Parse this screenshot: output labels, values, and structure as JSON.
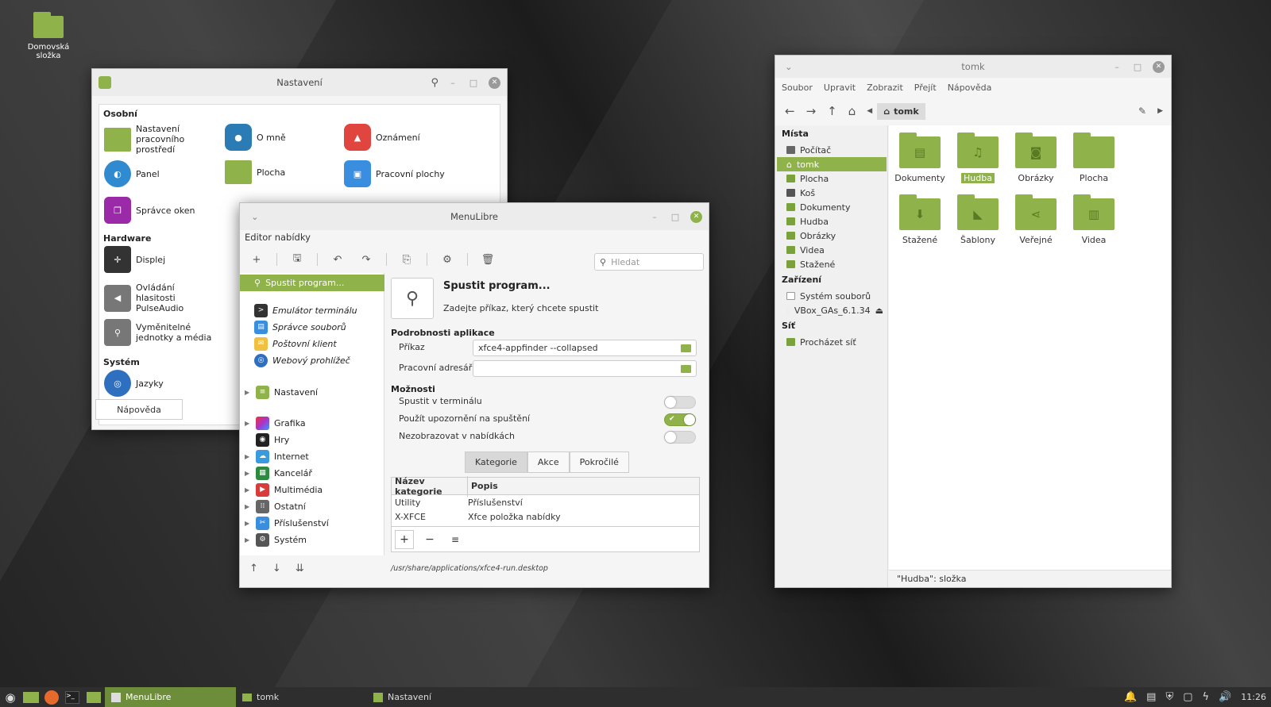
{
  "desktop": {
    "home_label": "Domovská složka"
  },
  "settings": {
    "title": "Nastavení",
    "help": "Nápověda",
    "sections": [
      "Osobní",
      "Hardware",
      "Systém"
    ],
    "items": {
      "desktop_env": "Nastavení pracovního prostředí",
      "about": "O mně",
      "notif": "Oznámení",
      "panel": "Panel",
      "plocha": "Plocha",
      "workspaces": "Pracovní plochy",
      "wm": "Správce oken",
      "display": "Displej",
      "audio": "Ovládání hlasitosti PulseAudio",
      "removable": "Vyměnitelné jednotky a média",
      "lang": "Jazyky"
    }
  },
  "menulibre": {
    "title": "MenuLibre",
    "subtitle": "Editor nabídky",
    "search_placeholder": "Hledat",
    "tree": {
      "selected": "Spustit program...",
      "children": [
        "Emulátor terminálu",
        "Správce souborů",
        "Poštovní klient",
        "Webový prohlížeč"
      ],
      "categories": [
        "Nastavení",
        "Grafika",
        "Hry",
        "Internet",
        "Kancelář",
        "Multimédia",
        "Ostatní",
        "Příslušenství",
        "Systém"
      ]
    },
    "app": {
      "name": "Spustit program...",
      "comment": "Zadejte příkaz, který chcete spustit"
    },
    "details_heading": "Podrobnosti aplikace",
    "command_label": "Příkaz",
    "command_value": "xfce4-appfinder --collapsed",
    "workdir_label": "Pracovní adresář",
    "workdir_value": "",
    "options_heading": "Možnosti",
    "options": [
      {
        "label": "Spustit v terminálu",
        "on": false
      },
      {
        "label": "Použít upozornění na spuštění",
        "on": true
      },
      {
        "label": "Nezobrazovat v nabídkách",
        "on": false
      }
    ],
    "tabs": [
      "Kategorie",
      "Akce",
      "Pokročilé"
    ],
    "table_headers": [
      "Název kategorie",
      "Popis"
    ],
    "table_rows": [
      [
        "Utility",
        "Příslušenství"
      ],
      [
        "X-XFCE",
        "Xfce položka nabídky"
      ]
    ],
    "path": "/usr/share/applications/xfce4-run.desktop"
  },
  "nemo": {
    "title": "tomk",
    "menu": [
      "Soubor",
      "Upravit",
      "Zobrazit",
      "Přejít",
      "Nápověda"
    ],
    "path_label": "tomk",
    "sidebar": {
      "places_heading": "Místa",
      "places": [
        "Počítač",
        "tomk",
        "Plocha",
        "Koš",
        "Dokumenty",
        "Hudba",
        "Obrázky",
        "Videa",
        "Stažené"
      ],
      "devices_heading": "Zařízení",
      "devices": [
        "Systém souborů",
        "VBox_GAs_6.1.34"
      ],
      "network_heading": "Síť",
      "network": [
        "Procházet síť"
      ]
    },
    "files": [
      "Dokumenty",
      "Hudba",
      "Obrázky",
      "Plocha",
      "Stažené",
      "Šablony",
      "Veřejné",
      "Videa"
    ],
    "status": "\"Hudba\": složka"
  },
  "taskbar": {
    "tasks": [
      "MenuLibre",
      "tomk",
      "Nastavení"
    ],
    "clock": "11:26"
  },
  "colors": {
    "accent": "#8fb34a"
  }
}
